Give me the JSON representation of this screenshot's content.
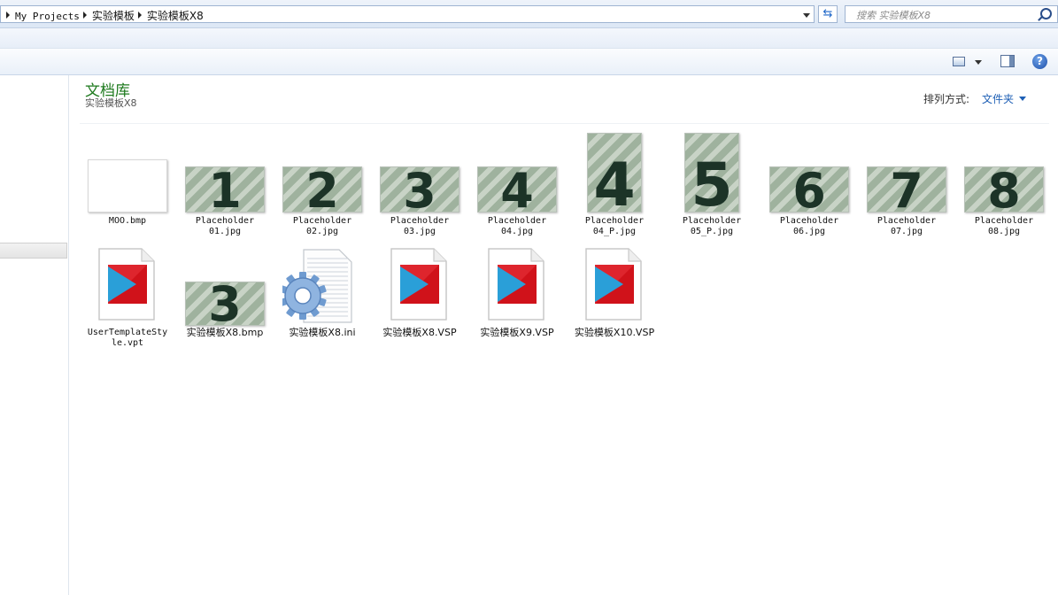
{
  "address": {
    "crumbs": [
      "My Projects",
      "实验模板",
      "实验模板X8"
    ]
  },
  "search": {
    "placeholder": "搜索 实验模板X8"
  },
  "toolbar": {
    "help_label": "?"
  },
  "library": {
    "title": "文档库",
    "subtitle": "实验模板X8",
    "arrange_label": "排列方式:",
    "arrange_value": "文件夹"
  },
  "files_row1": [
    {
      "name": "MOO.bmp",
      "thumb": "blank",
      "glyph": ""
    },
    {
      "name": "Placeholder\n01.jpg",
      "thumb": "wide",
      "glyph": "1"
    },
    {
      "name": "Placeholder\n02.jpg",
      "thumb": "wide",
      "glyph": "2"
    },
    {
      "name": "Placeholder\n03.jpg",
      "thumb": "wide",
      "glyph": "3"
    },
    {
      "name": "Placeholder\n04.jpg",
      "thumb": "wide",
      "glyph": "4"
    },
    {
      "name": "Placeholder\n04_P.jpg",
      "thumb": "tall",
      "glyph": "4"
    },
    {
      "name": "Placeholder\n05_P.jpg",
      "thumb": "tall",
      "glyph": "5"
    },
    {
      "name": "Placeholder\n06.jpg",
      "thumb": "wide",
      "glyph": "6"
    },
    {
      "name": "Placeholder\n07.jpg",
      "thumb": "wide",
      "glyph": "7"
    },
    {
      "name": "Placeholder\n08.jpg",
      "thumb": "wide",
      "glyph": "8"
    }
  ],
  "files_row2": [
    {
      "name": "UserTemplateSty\nle.vpt",
      "icon": "vsp-doc-icon"
    },
    {
      "name": "实验模板X8.bmp",
      "icon": "thumb-3",
      "glyph": "3"
    },
    {
      "name": "实验模板X8.ini",
      "icon": "ini-settings-icon"
    },
    {
      "name": "实验模板X8.VSP",
      "icon": "vsp-doc-icon"
    },
    {
      "name": "实验模板X9.VSP",
      "icon": "vsp-doc-icon"
    },
    {
      "name": "实验模板X10.VSP",
      "icon": "vsp-doc-icon"
    }
  ],
  "colors": {
    "library_title": "#1e7a1e",
    "arrange_value": "#1e5fb5",
    "vsp_red": "#d0121a",
    "vsp_blue": "#2a9fd8"
  }
}
